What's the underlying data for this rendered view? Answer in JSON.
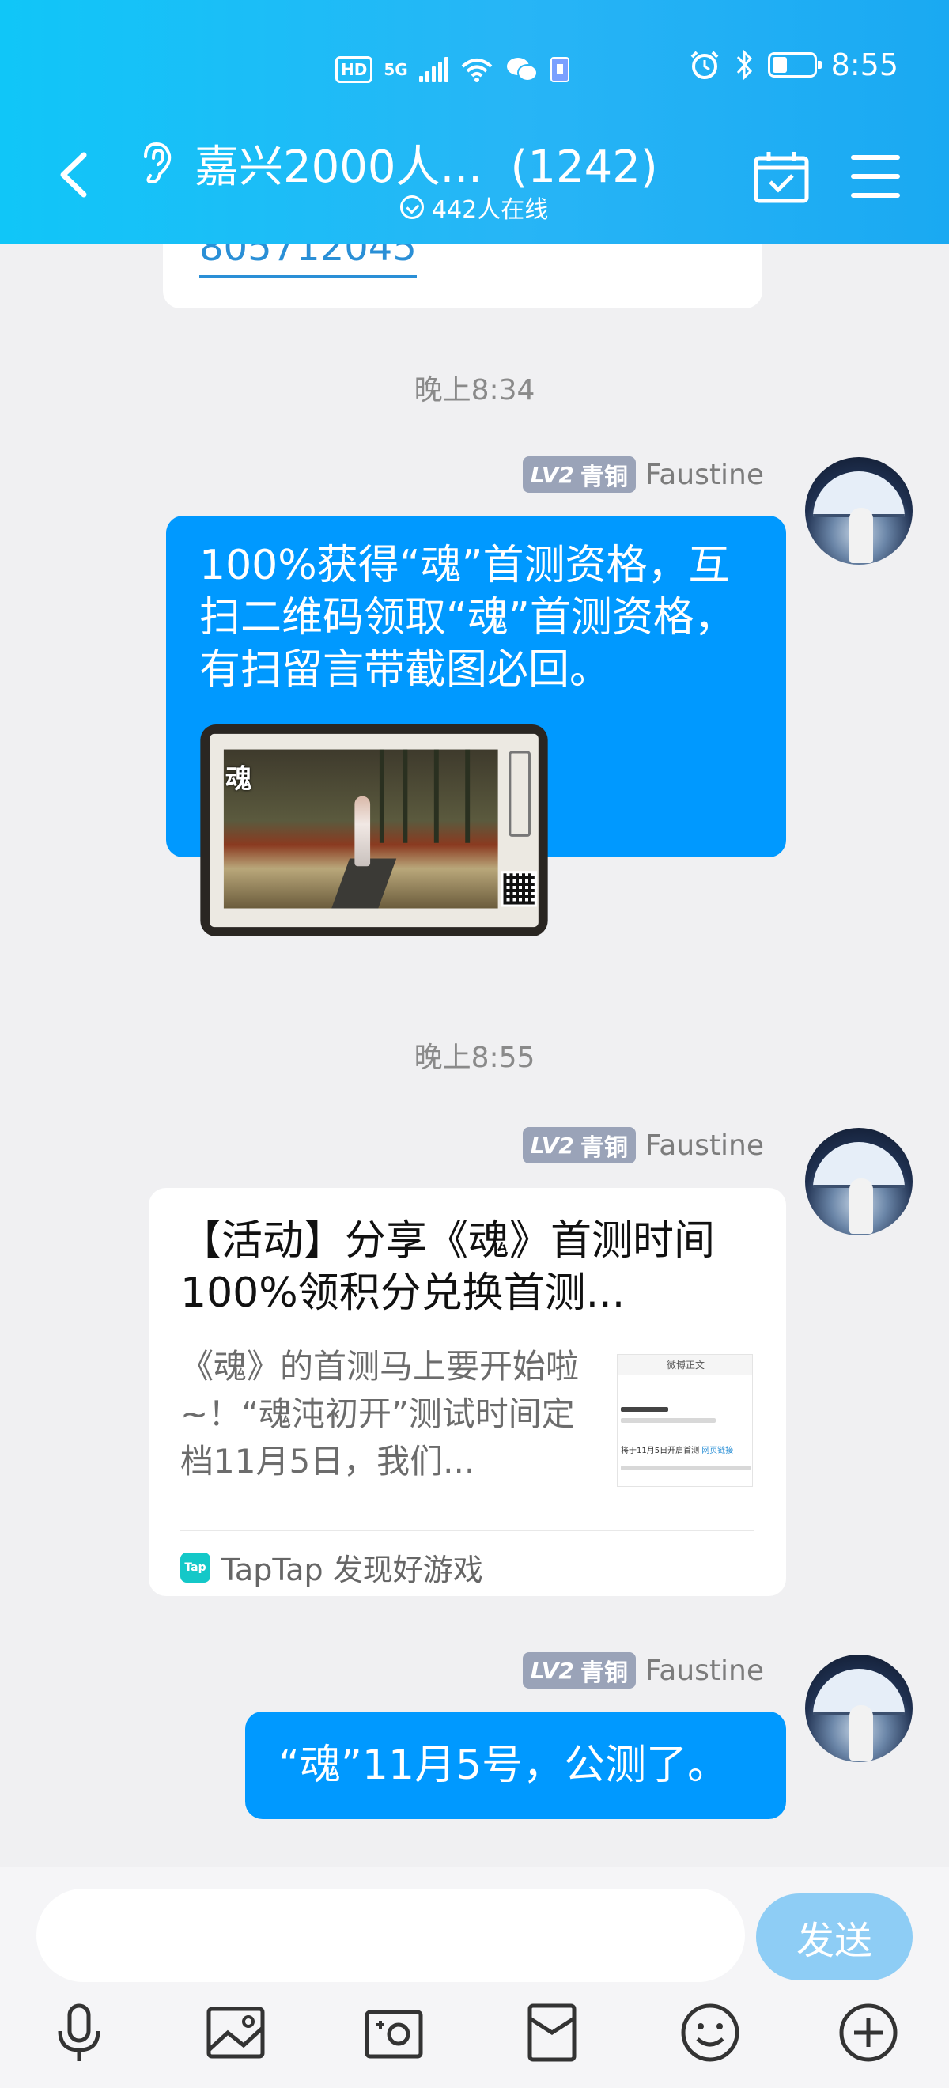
{
  "status_bar": {
    "hd": "HD",
    "network": "5G",
    "time": "8:55",
    "icons": [
      "signal-icon",
      "wifi-icon",
      "wechat-icon",
      "sim-icon",
      "alarm-icon",
      "bluetooth-icon",
      "battery-icon"
    ]
  },
  "header": {
    "title": "嘉兴2000人...  (1242)",
    "online_text": "442人在线",
    "icons": [
      "back-icon",
      "ear-icon",
      "calendar-check-icon",
      "menu-icon"
    ]
  },
  "messages": {
    "previous_link": "805712045",
    "time1": "晚上8:34",
    "time2": "晚上8:55",
    "sender": {
      "level": "LV2",
      "rank": "青铜",
      "name": "Faustine"
    },
    "msg1_text": "100%获得“魂”首测资格，互扫二维码领取“魂”首测资格，有扫留言带截图必回。",
    "msg1_image_logo": "魂",
    "card": {
      "title": "【活动】分享《魂》首测时间 100%领积分兑换首测...",
      "desc": "《魂》的首测马上要开始啦~！“魂沌初开”测试时间定档11月5日，我们...",
      "thumb_header": "微博正文",
      "thumb_line": "将于11月5日开启首测",
      "thumb_link": "网页链接",
      "source_logo": "Tap",
      "source": "TapTap 发现好游戏"
    },
    "msg3_text": "“魂”11月5号，公测了。"
  },
  "composer": {
    "input_value": "",
    "send_label": "发送",
    "tools": [
      "microphone-icon",
      "image-icon",
      "camera-icon",
      "red-packet-icon",
      "emoji-icon",
      "plus-icon"
    ]
  },
  "colors": {
    "header_gradient_start": "#10c6f8",
    "header_gradient_end": "#1aa9f2",
    "bubble_blue": "#0099ff",
    "send_button": "#8ecdf5",
    "level_badge": "#9aa3b8"
  }
}
